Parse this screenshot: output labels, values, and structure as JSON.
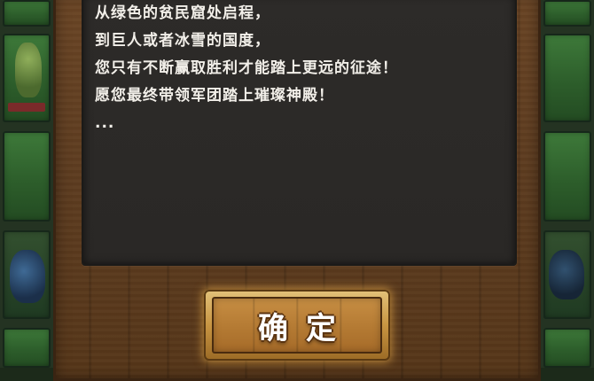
{
  "dialog": {
    "story_lines": [
      "从绿色的贫民窟处启程，",
      "到巨人或者冰雪的国度，",
      "您只有不断赢取胜利才能踏上更远的征途！",
      "愿您最终带领军团踏上璀璨神殿！",
      "..."
    ],
    "confirm_label": "确定"
  },
  "side_cards": {
    "left": [
      "orc-card",
      "empty-card",
      "empty-card",
      "blue-beast-card"
    ],
    "right": [
      "empty-card",
      "empty-card",
      "empty-card",
      "blue-beast-card"
    ]
  }
}
